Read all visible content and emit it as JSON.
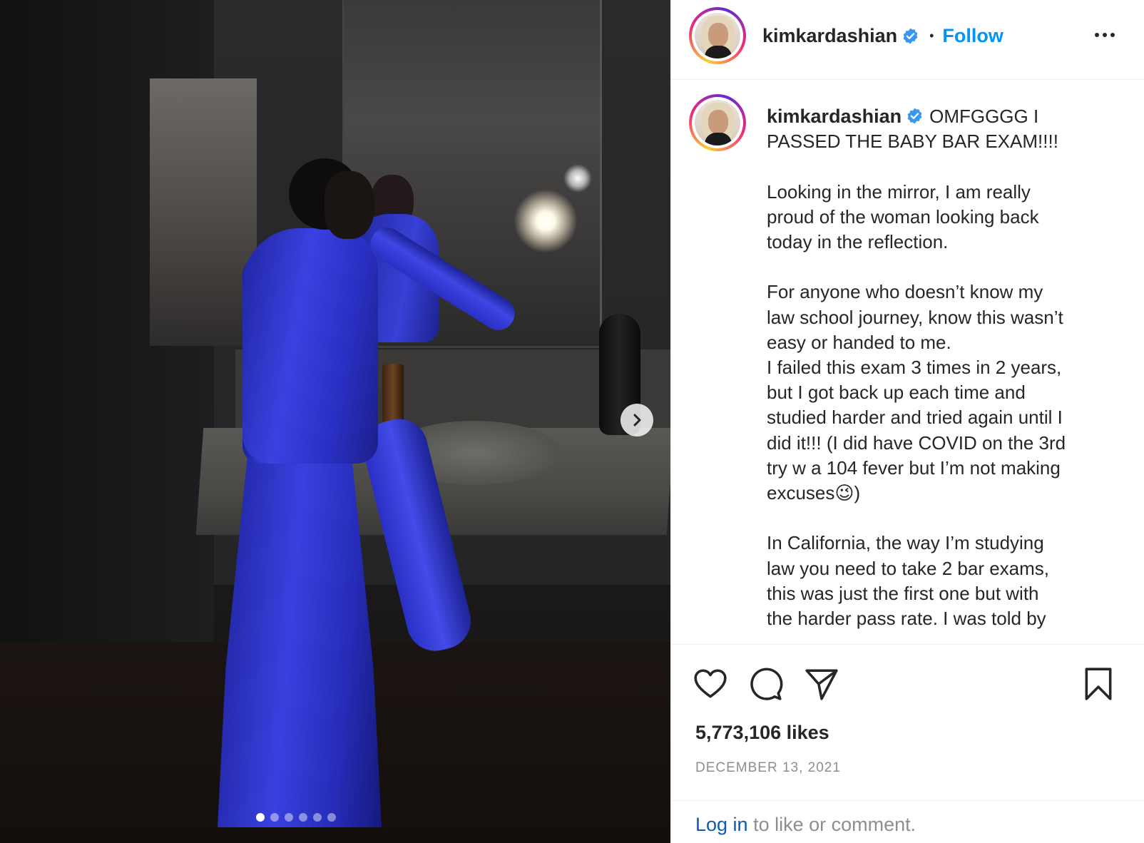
{
  "post": {
    "username": "kimkardashian",
    "follow_label": "Follow",
    "separator": "•",
    "caption_lines": [
      "OMFGGGG I",
      "PASSED THE BABY BAR EXAM!!!!",
      "",
      "Looking in the mirror, I am really",
      "proud of the woman looking back",
      "today in the reflection.",
      "",
      "For anyone who doesn’t know my",
      "law school journey, know this wasn’t",
      "easy or handed to me.",
      "I failed this exam 3 times in 2 years,",
      "but I got back up each time and",
      "studied harder and tried again until I",
      "did it!!! (I did have COVID on the 3rd",
      "try w a 104 fever but I’m not making",
      "excuses😉)",
      "",
      "In California, the way I’m studying",
      "law you need to take 2 bar exams,",
      "this was just the first one but with",
      "the harder pass rate. I was told by"
    ],
    "likes": "5,773,106 likes",
    "date": "DECEMBER 13, 2021",
    "login_link": "Log in",
    "login_rest": " to like or comment."
  },
  "carousel": {
    "total": 6,
    "active_index": 0
  },
  "icons": {
    "verified": "verified-badge-icon",
    "more": "more-options-icon",
    "like": "heart-icon",
    "comment": "comment-bubble-icon",
    "share": "paper-plane-icon",
    "save": "bookmark-icon",
    "next": "chevron-right-icon"
  },
  "colors": {
    "accent": "#0095f6",
    "text": "#262626",
    "muted": "#8e8e8e",
    "border": "#efefef",
    "gown": "#3a41e0"
  }
}
